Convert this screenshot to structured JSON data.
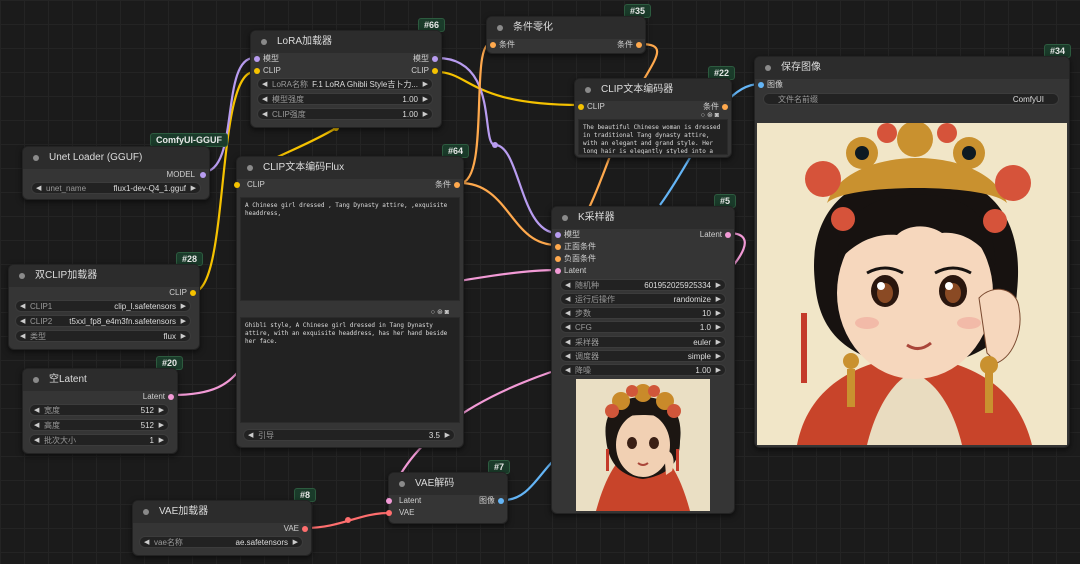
{
  "colors": {
    "clip": "#f5c200",
    "model": "#b89cf0",
    "latent": "#f29ad6",
    "image": "#64b5f6",
    "vae": "#ff6e6e",
    "cond": "#ffa94d"
  },
  "nodes": {
    "unet": {
      "id": "",
      "title": "Unet Loader (GGUF)",
      "badge": "ComfyUI-GGUF",
      "out_model": "MODEL",
      "w_label": "unet_name",
      "w_value": "flux1-dev-Q4_1.gguf"
    },
    "dualclip": {
      "id": "#28",
      "title": "双CLIP加载器",
      "out_clip": "CLIP",
      "w1_label": "CLIP1",
      "w1_value": "clip_l.safetensors",
      "w2_label": "CLIP2",
      "w2_value": "t5xxl_fp8_e4m3fn.safetensors",
      "w3_label": "类型",
      "w3_value": "flux"
    },
    "latent": {
      "id": "#20",
      "title": "空Latent",
      "out": "Latent",
      "w1_label": "宽度",
      "w1_value": "512",
      "w2_label": "高度",
      "w2_value": "512",
      "w3_label": "批次大小",
      "w3_value": "1"
    },
    "vaeload": {
      "id": "#8",
      "title": "VAE加载器",
      "out": "VAE",
      "w_label": "vae名称",
      "w_value": "ae.safetensors"
    },
    "lora": {
      "id": "#66",
      "title": "LoRA加载器",
      "in_model": "模型",
      "in_clip": "CLIP",
      "out_model": "模型",
      "out_clip": "CLIP",
      "w1_label": "LoRA名称",
      "w1_value": "F.1 LoRA Ghibli Style吉卜力...",
      "w2_label": "模型强度",
      "w2_value": "1.00",
      "w3_label": "CLIP强度",
      "w3_value": "1.00"
    },
    "clipflux": {
      "id": "#64",
      "title": "CLIP文本编码Flux",
      "in_clip": "CLIP",
      "out": "条件",
      "text1": "A Chinese girl dressed , Tang Dynasty attire, ,exquisite headdress,",
      "text2": "Ghibli style, A Chinese girl dressed in Tang Dynasty attire, with an exquisite headdress, has her hand beside her face.",
      "w_label": "引导",
      "w_value": "3.5"
    },
    "condzero": {
      "id": "#35",
      "title": "条件零化",
      "in": "条件",
      "out": "条件"
    },
    "clipenc": {
      "id": "#22",
      "title": "CLIP文本编码器",
      "in_clip": "CLIP",
      "out": "条件",
      "text": "The beautiful Chinese woman is dressed in traditional Tang dynasty attire, with an elegant and grand style. Her long hair is elegantly styled into a bun, adorned with delicate hair ornaments that add a touch of"
    },
    "ksampler": {
      "id": "#5",
      "title": "K采样器",
      "in_model": "模型",
      "in_pos": "正面条件",
      "in_neg": "负面条件",
      "in_latent": "Latent",
      "out": "Latent",
      "widgets": [
        {
          "label": "随机种",
          "value": "601952025925334"
        },
        {
          "label": "运行后操作",
          "value": "randomize"
        },
        {
          "label": "步数",
          "value": "10"
        },
        {
          "label": "CFG",
          "value": "1.0"
        },
        {
          "label": "采样器",
          "value": "euler"
        },
        {
          "label": "调度器",
          "value": "simple"
        },
        {
          "label": "降噪",
          "value": "1.00"
        }
      ]
    },
    "vaedecode": {
      "id": "#7",
      "title": "VAE解码",
      "in_latent": "Latent",
      "in_vae": "VAE",
      "out": "图像"
    },
    "save": {
      "id": "#34",
      "title": "保存图像",
      "in": "图像",
      "w_label": "文件名前缀",
      "w_value": "ComfyUI"
    }
  }
}
